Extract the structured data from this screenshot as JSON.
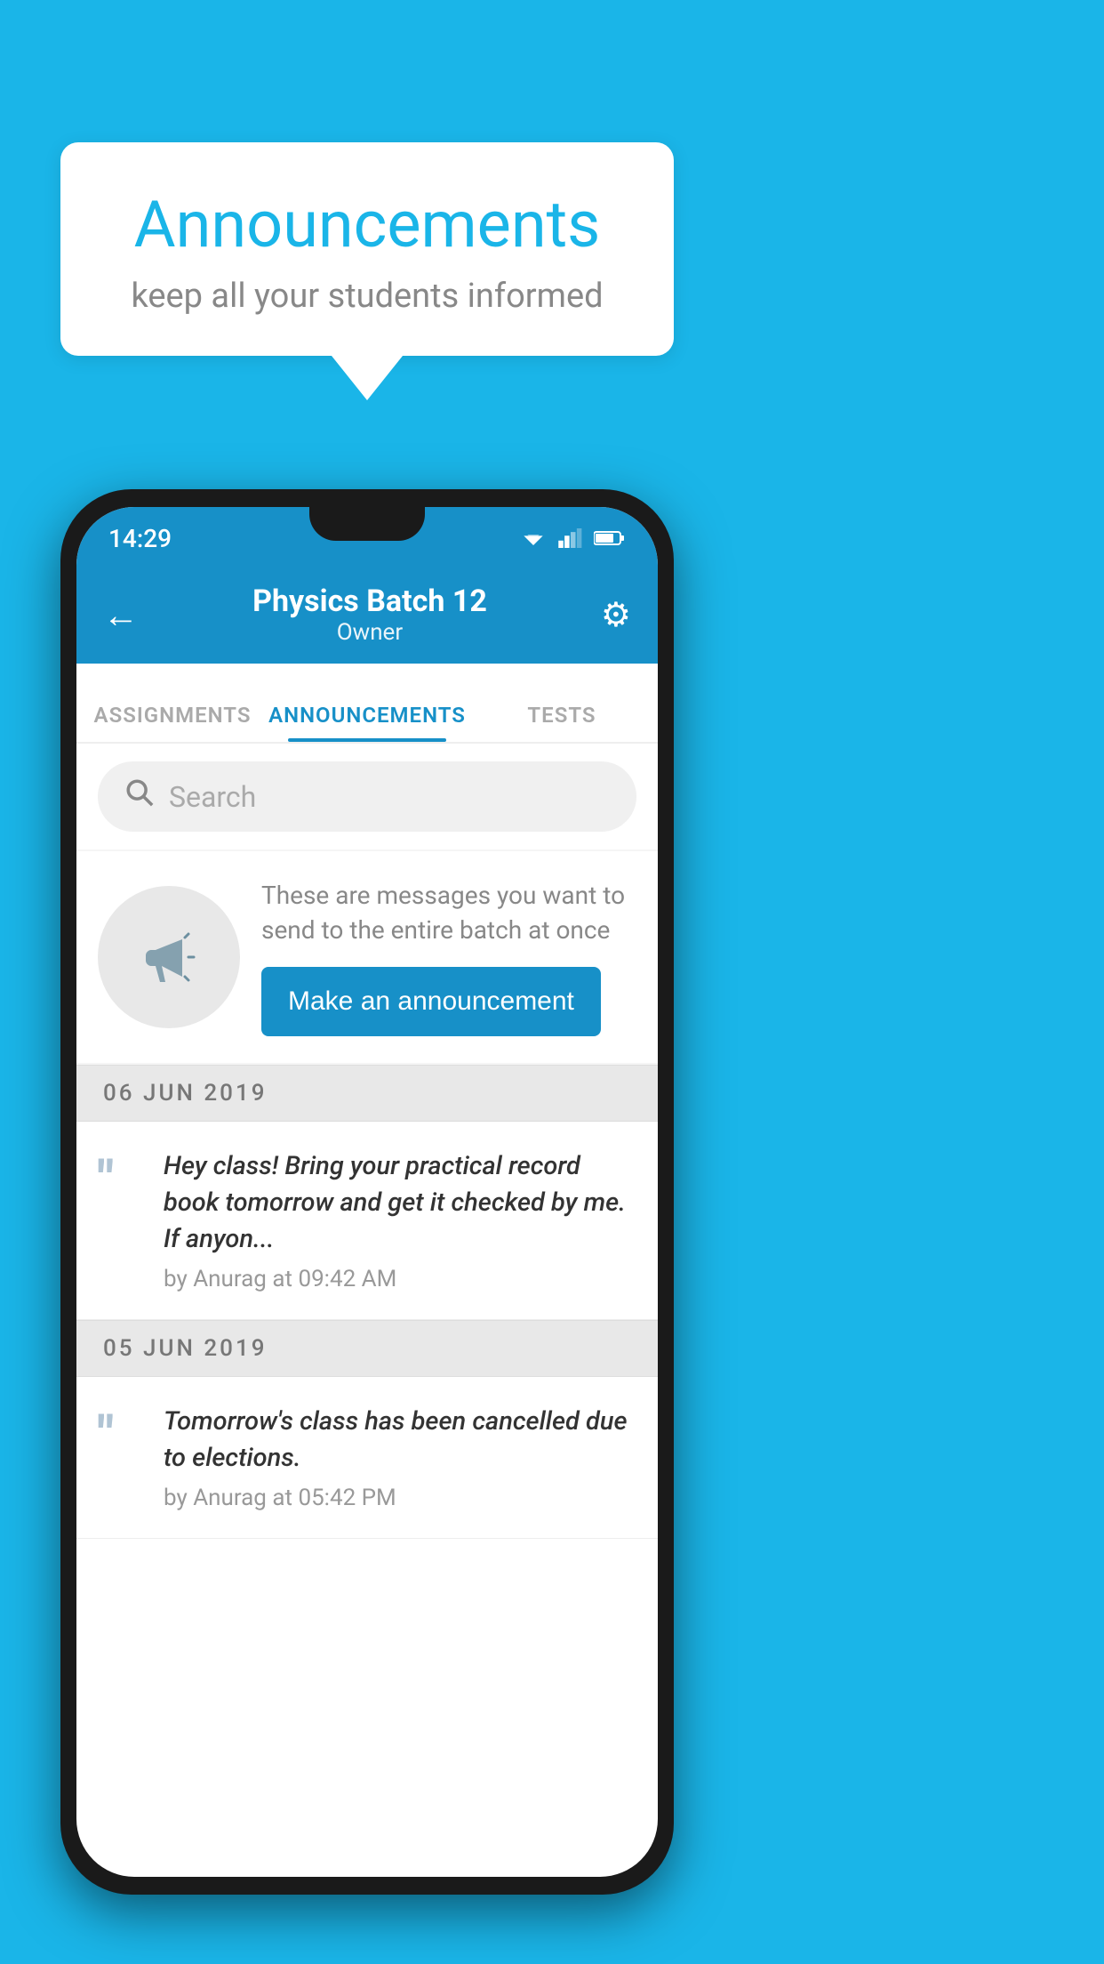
{
  "background_color": "#1ab5e8",
  "speech_bubble": {
    "title": "Announcements",
    "subtitle": "keep all your students informed"
  },
  "status_bar": {
    "time": "14:29"
  },
  "app_header": {
    "title": "Physics Batch 12",
    "subtitle": "Owner",
    "back_label": "←",
    "gear_label": "⚙"
  },
  "tabs": [
    {
      "label": "ASSIGNMENTS",
      "active": false
    },
    {
      "label": "ANNOUNCEMENTS",
      "active": true
    },
    {
      "label": "TESTS",
      "active": false
    }
  ],
  "search": {
    "placeholder": "Search"
  },
  "promo": {
    "description": "These are messages you want to send to the entire batch at once",
    "button_label": "Make an announcement"
  },
  "announcements": [
    {
      "date": "06  JUN  2019",
      "text": "Hey class! Bring your practical record book tomorrow and get it checked by me. If anyon...",
      "meta": "by Anurag at 09:42 AM"
    },
    {
      "date": "05  JUN  2019",
      "text": "Tomorrow's class has been cancelled due to elections.",
      "meta": "by Anurag at 05:42 PM"
    }
  ]
}
